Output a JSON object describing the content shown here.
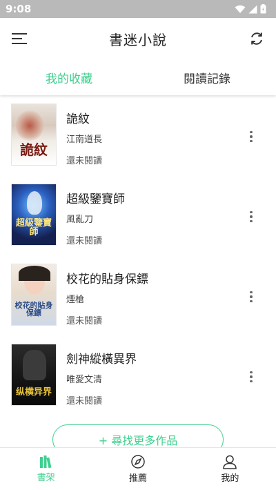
{
  "status_bar": {
    "time": "9:08"
  },
  "app_bar": {
    "title": "書迷小說"
  },
  "tabs": [
    {
      "label": "我的收藏",
      "active": true
    },
    {
      "label": "閱讀記錄",
      "active": false
    }
  ],
  "books": [
    {
      "title": "詭紋",
      "author": "江南道長",
      "status": "還未閱讀",
      "cover_text": "詭紋"
    },
    {
      "title": "超級鑒寶師",
      "author": "風亂刀",
      "status": "還未閱讀",
      "cover_text": "超級鑒寶師"
    },
    {
      "title": "校花的貼身保鏢",
      "author": "煙槍",
      "status": "還未閱讀",
      "cover_text": "校花的貼身保鏢"
    },
    {
      "title": "劍神縱橫異界",
      "author": "唯愛文清",
      "status": "還未閱讀",
      "cover_text": "纵横异界"
    }
  ],
  "find_more": {
    "label": "+ 尋找更多作品"
  },
  "bottom_nav": [
    {
      "label": "書架",
      "icon": "bookshelf-icon",
      "active": true
    },
    {
      "label": "推薦",
      "icon": "compass-icon",
      "active": false
    },
    {
      "label": "我的",
      "icon": "user-icon",
      "active": false
    }
  ],
  "colors": {
    "accent": "#3fcf8e",
    "status_bar": "#b9b9b9"
  }
}
